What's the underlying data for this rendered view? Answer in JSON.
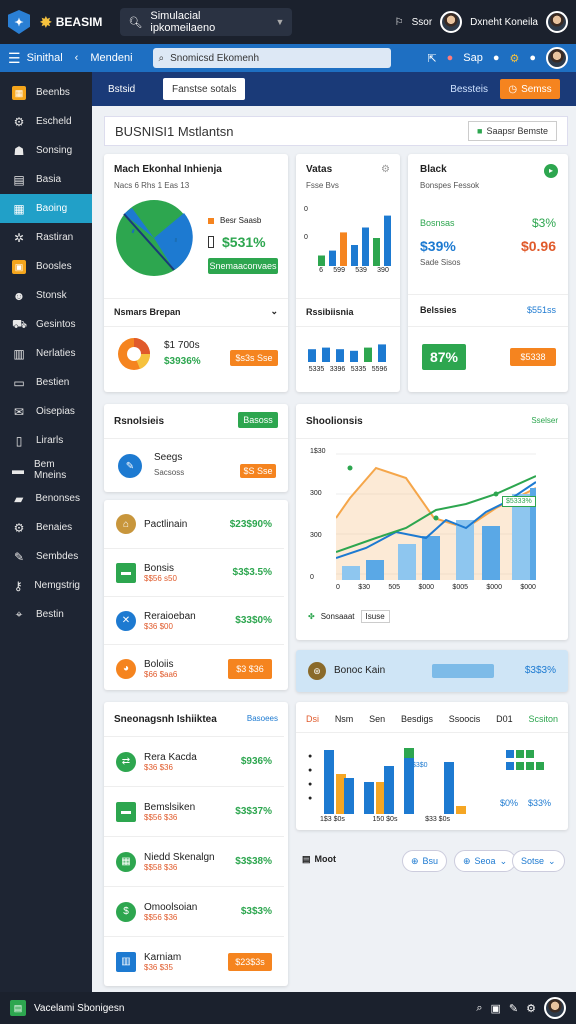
{
  "topbar": {
    "brand": "BEASIM",
    "search": "Simulacial ipkomeilaeno",
    "user": "Dxneht Koneila",
    "sign": "Ssor"
  },
  "navbar": {
    "title": "Sinithal",
    "item": "Mendeni",
    "input": "Snomicsd Ekomenh",
    "icon_label": "Sap"
  },
  "sidebar": {
    "items": [
      {
        "label": "Beenbs",
        "icon": "grid-icon",
        "active": false
      },
      {
        "label": "Escheld",
        "icon": "gear-icon",
        "active": false
      },
      {
        "label": "Sonsing",
        "icon": "people-icon",
        "active": false
      },
      {
        "label": "Basia",
        "icon": "doc-icon",
        "active": false
      },
      {
        "label": "Baoing",
        "icon": "table-icon",
        "active": true
      },
      {
        "label": "Rastiran",
        "icon": "settings-icon",
        "active": false
      },
      {
        "label": "Boosles",
        "icon": "box-icon",
        "active": false
      },
      {
        "label": "Stonsk",
        "icon": "user-icon",
        "active": false
      },
      {
        "label": "Gesintos",
        "icon": "cart-icon",
        "active": false
      },
      {
        "label": "Nerlaties",
        "icon": "chart-icon",
        "active": false
      },
      {
        "label": "Bestien",
        "icon": "monitor-icon",
        "active": false
      },
      {
        "label": "Oisepias",
        "icon": "mail-icon",
        "active": false
      },
      {
        "label": "Lirarls",
        "icon": "book-icon",
        "active": false
      },
      {
        "label": "Bem Mneins",
        "icon": "card-icon",
        "active": false
      },
      {
        "label": "Benonses",
        "icon": "wallet-icon",
        "active": false
      },
      {
        "label": "Benaies",
        "icon": "gear-icon",
        "active": false
      },
      {
        "label": "Sembdes",
        "icon": "pen-icon",
        "active": false
      },
      {
        "label": "Nemgstrig",
        "icon": "key-icon",
        "active": false
      },
      {
        "label": "Bestin",
        "icon": "tag-icon",
        "active": false
      }
    ]
  },
  "subnav": {
    "title": "Bstsid",
    "tab": "Fanstse sotals",
    "select": "Bessteis",
    "action": "Semss"
  },
  "header": {
    "title": "BUSNISI1 Mstlantsn",
    "button": "Saapsr Bemste"
  },
  "pie_card": {
    "title": "Mach Ekonhal Inhienja",
    "subtitle": "Nacs 6 Rhs 1 Eas 13",
    "legend_label": "Besr Saasb",
    "value": "$531%",
    "button": "Snemaaconvaes",
    "footer": "Nsmars Brepan"
  },
  "vtasa": {
    "title": "Vatas",
    "sub": "Fsse Bvs",
    "y1": "0",
    "y2": "0",
    "x": [
      "6",
      "599",
      "539",
      "390"
    ],
    "values": [
      15,
      22,
      48,
      30,
      55,
      40,
      72
    ],
    "footer": "Rssibiisnia"
  },
  "black": {
    "title": "Black",
    "sub": "Bonspes Fessok",
    "l1": "Bosnsas",
    "v1": "$3%",
    "big1": "$39%",
    "big2": "$0.96",
    "note": "Sade Sisos",
    "footer": "Belssies",
    "footer_val": "$551ss"
  },
  "mini_pie": {
    "value": "$1 700s",
    "pct": "$3936%",
    "button": "$s3s Sse"
  },
  "mini_bars": {
    "x": [
      "5335",
      "3396",
      "5335",
      "5596"
    ],
    "values": [
      40,
      45,
      40,
      35,
      45,
      55
    ]
  },
  "pct_card": {
    "value": "87%",
    "button": "$5338"
  },
  "rcol": {
    "title": "Rsnolsieis",
    "button": "Basoss",
    "item_label": "Seegs",
    "item_sub": "Sacsoss",
    "item_btn": "$S Sse"
  },
  "list1": [
    {
      "label": "Pactlinain",
      "sub": "",
      "val": "$23$90%",
      "color": "#c8963c",
      "icon": "briefcase-icon"
    },
    {
      "label": "Bonsis",
      "sub": "$$56 s50",
      "val": "$3$3.5%",
      "color": "#2da64f",
      "icon": "cash-icon"
    },
    {
      "label": "Reraioeban",
      "sub": "$36 $00",
      "val": "$33$0%",
      "color": "#1d7ad1",
      "icon": "tools-icon"
    },
    {
      "label": "Boloiis",
      "sub": "$66 $aa6",
      "val": "$3 $36",
      "color": "#f5841f",
      "icon": "pie-icon"
    }
  ],
  "shoo": {
    "title": "Shoolionsis",
    "badge": "Sselser",
    "ylabels": [
      "1$30",
      "300",
      "300",
      "0"
    ],
    "xlabels": [
      "0",
      "$30",
      "505",
      "$000",
      "$005",
      "$000",
      "$000"
    ],
    "annot": "$5333%",
    "legend": "Sonsaaat",
    "legend2": "Isuse"
  },
  "promo": {
    "label": "Bonoc Kain",
    "val": "$3$3%"
  },
  "list2": {
    "title": "Sneonagsnh Ishiiktea",
    "link": "Basoees",
    "items": [
      {
        "label": "Rera Kacda",
        "sub": "$36 $36",
        "val": "$936%",
        "color": "#2da64f",
        "icon": "arrows-icon"
      },
      {
        "label": "Bemslsiken",
        "sub": "$$56 $36",
        "val": "$3$37%",
        "color": "#2da64f",
        "icon": "cash-icon"
      },
      {
        "label": "Niedd Skenalgn",
        "sub": "$$58 $36",
        "val": "$3$38%",
        "color": "#2da64f",
        "icon": "calendar-icon"
      },
      {
        "label": "Omoolsoian",
        "sub": "$$56 $36",
        "val": "$3$3%",
        "color": "#2da64f",
        "icon": "coin-icon"
      },
      {
        "label": "Karniam",
        "sub": "$36 $35",
        "val": "$23$3s",
        "color": "#1d7ad1",
        "icon": "chart-icon",
        "btn": true
      }
    ]
  },
  "bars2": {
    "tabs": [
      "Dsi",
      "Nsm",
      "Sen",
      "Besdigs",
      "Ssoocis",
      "D01",
      "Scsiton"
    ],
    "blue": [
      80,
      45,
      40,
      60,
      75,
      0,
      65,
      0
    ],
    "orange": [
      50,
      0,
      40,
      0,
      0,
      0,
      10,
      0
    ],
    "xlabels": [
      "1$3 $0s",
      "150 $0s",
      "$33 $0s"
    ],
    "v1": "$0%",
    "v2": "$33%",
    "annot": "$3$0"
  },
  "bottom_panel": {
    "label": "Moot",
    "b1": "Bsu",
    "b2": "Seoa",
    "b3": "Sotse"
  },
  "bottombar": {
    "label": "Vacelami Sbonigesn"
  }
}
